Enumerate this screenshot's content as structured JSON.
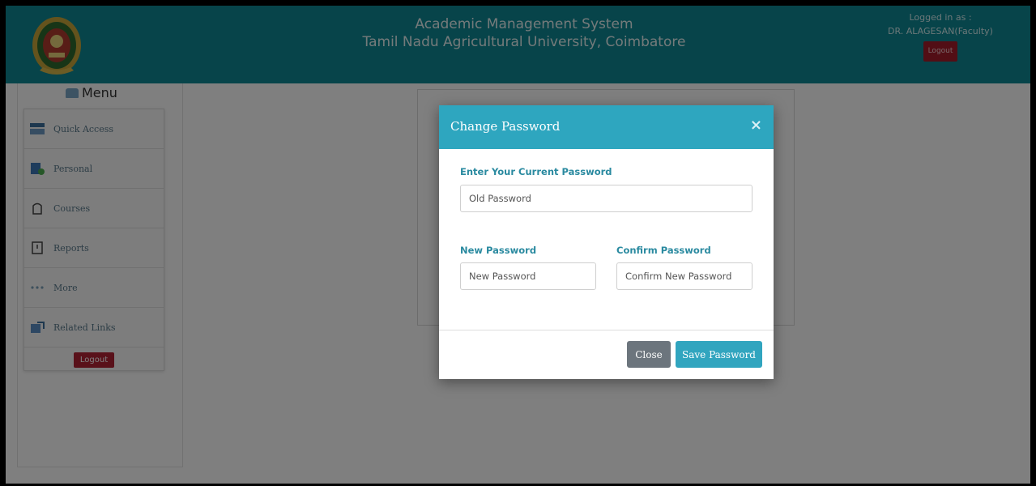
{
  "header": {
    "title_line1": "Academic Management System",
    "title_line2": "Tamil Nadu Agricultural University, Coimbatore",
    "logged_in_label": "Logged in as :",
    "user_name": "DR. ALAGESAN(Faculty)",
    "logout_label": "Logout"
  },
  "menu": {
    "title": "Menu",
    "items": [
      {
        "label": "Quick Access",
        "icon": "quick-access-icon"
      },
      {
        "label": "Personal",
        "icon": "personal-icon"
      },
      {
        "label": "Courses",
        "icon": "courses-icon"
      },
      {
        "label": "Reports",
        "icon": "reports-icon"
      },
      {
        "label": "More",
        "icon": "more-dots-icon"
      },
      {
        "label": "Related Links",
        "icon": "related-links-icon"
      }
    ],
    "logout_label": "Logout"
  },
  "modal": {
    "title": "Change Password",
    "close_symbol": "×",
    "current_password_label": "Enter Your Current Password",
    "current_password_placeholder": "Old Password",
    "new_password_label": "New Password",
    "new_password_placeholder": "New Password",
    "confirm_password_label": "Confirm Password",
    "confirm_password_placeholder": "Confirm New Password",
    "close_button": "Close",
    "save_button": "Save Password"
  },
  "colors": {
    "header_bg": "#0e8995",
    "modal_header_bg": "#2ea6bf",
    "logout_red": "#b22234",
    "label_teal": "#2a8aa0"
  }
}
